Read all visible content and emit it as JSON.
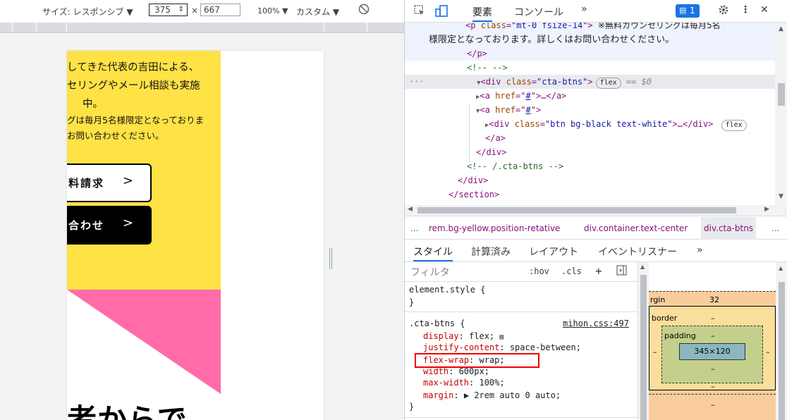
{
  "device_toolbar": {
    "size_label": "サイズ: レスポンシブ ▼",
    "width": "375",
    "times": "×",
    "height": "667",
    "zoom": "100% ▼",
    "throttle": "カスタム ▼"
  },
  "page": {
    "text_lines": [
      "してきた代表の吉田による、",
      "セリングやメール相談も実施",
      "中。",
      "グは毎月5名様限定となっておりま",
      "お問い合わせください。"
    ],
    "cta_buttons": [
      {
        "label": "料請求",
        "arrow": ">"
      },
      {
        "label": "合わせ",
        "arrow": ">"
      }
    ],
    "bottom_heading": "者からで",
    "colors": {
      "yellow": "#ffe246",
      "pink": "#ff6ca8"
    }
  },
  "devtools": {
    "tabs": {
      "elements": "要素",
      "console": "コンソール",
      "more": "»"
    },
    "issues_count": "1",
    "dom_tree": {
      "r0_tag_open": "<p",
      "r0_attr_name": "class",
      "r0_attr_value": "\"mt-0 fsize-14\"",
      "r0_text": "※無料カウンセリングは毎月5名",
      "r1_text": "様限定となっております。詳しくはお問い合わせください。",
      "r2_close_p": "</p>",
      "r3_comment": "<!-- -->",
      "r4_tag_open": "<div",
      "r4_attr_name": "class",
      "r4_attr_value": "\"cta-btns\"",
      "r4_tag_close": ">",
      "r4_pill": "flex",
      "r4_eq": "== $0",
      "r5_tag": "<a",
      "r5_attr_name": "href",
      "r5_attr_value": "#",
      "r5_rest": ">…</a>",
      "r6_tag": "<a",
      "r6_attr_name": "href",
      "r6_attr_value": "#",
      "r6_rest": ">",
      "r7_tag": "<div",
      "r7_attr_name": "class",
      "r7_attr_value": "\"btn bg-black text-white\"",
      "r7_rest": ">…</div>",
      "r7_pill": "flex",
      "r8_close_a": "</a>",
      "r9_close_div": "</div>",
      "r10_comment": "<!-- /.cta-btns -->",
      "r11_close_div": "</div>",
      "r12_close_section": "</section>"
    },
    "breadcrumb": {
      "ellipsis": "...",
      "b1": "rem.bg-yellow.position-retative",
      "b2": "div.container.text-center",
      "b3": "div.cta-btns",
      "more": "..."
    },
    "styles_tabs": {
      "styles": "スタイル",
      "computed": "計算済み",
      "layout": "レイアウト",
      "listeners": "イベントリスナー",
      "more": "»"
    },
    "filter_placeholder": "フィルタ",
    "filter_options": {
      "hov": ":hov",
      "cls": ".cls",
      "plus": "+"
    },
    "element_style": {
      "selector": "element.style {",
      "close": "}"
    },
    "rule": {
      "selector": ".cta-btns {",
      "source": "mihon.css:497",
      "props": [
        {
          "name": "display",
          "value": "flex;"
        },
        {
          "name": "justify-content",
          "value": "space-between;"
        },
        {
          "name": "flex-wrap",
          "value": "wrap;"
        },
        {
          "name": "width",
          "value": "600px;"
        },
        {
          "name": "max-width",
          "value": "100%;"
        },
        {
          "name": "margin",
          "value": "▶ 2rem auto 0 auto;"
        }
      ],
      "close": "}"
    },
    "boxmodel": {
      "margin_label": "rgin",
      "margin_top": "32",
      "border_label": "border",
      "border_top": "–",
      "padding_label": "padding",
      "padding_top": "–",
      "padding_bottom": "–",
      "content_size": "345×120",
      "side_left": "–",
      "side_right": "–",
      "border_bottom": "–",
      "margin_bottom": "–"
    }
  }
}
